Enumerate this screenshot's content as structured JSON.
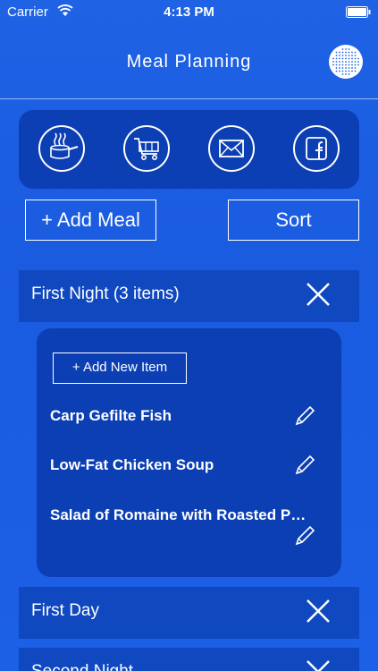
{
  "status_bar": {
    "carrier": "Carrier",
    "time": "4:13 PM"
  },
  "nav": {
    "title": "Meal Planning",
    "menu_icon": "dotted-grid-icon"
  },
  "share_buttons": [
    {
      "icon": "cooking-pot-icon"
    },
    {
      "icon": "shopping-cart-icon"
    },
    {
      "icon": "mail-icon"
    },
    {
      "icon": "facebook-icon"
    }
  ],
  "actions": {
    "add_meal_label": "+ Add Meal",
    "sort_label": "Sort"
  },
  "meals": [
    {
      "label": "First Night (3 items)",
      "expanded": true,
      "add_item_label": "+ Add New Item",
      "items": [
        {
          "label": "Carp Gefilte Fish"
        },
        {
          "label": "Low-Fat Chicken Soup"
        },
        {
          "label": "Salad of Romaine with Roasted P…"
        }
      ]
    },
    {
      "label": "First Day"
    },
    {
      "label": "Second Night"
    }
  ],
  "colors": {
    "background": "#1f62e4",
    "panel": "#0c3fb4",
    "header": "#1048bf",
    "text": "#ffffff"
  }
}
